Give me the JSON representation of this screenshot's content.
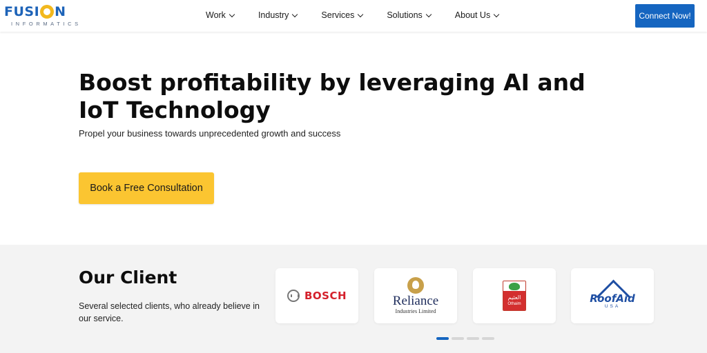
{
  "brand": {
    "name_part1": "FUSI",
    "name_part2": "N",
    "tagline": "INFORMATICS",
    "brand_blue": "#1d63b8",
    "brand_yellow": "#f2b81d"
  },
  "nav": {
    "items": [
      {
        "label": "Work",
        "icon": "chevron-down-icon"
      },
      {
        "label": "Industry",
        "icon": "chevron-down-icon"
      },
      {
        "label": "Services",
        "icon": "chevron-down-icon"
      },
      {
        "label": "Solutions",
        "icon": "chevron-down-icon"
      },
      {
        "label": "About Us",
        "icon": "chevron-down-icon"
      }
    ],
    "cta_label": "Connect Now!",
    "cta_color": "#1565c0"
  },
  "hero": {
    "title": "Boost profitability by leveraging AI and IoT Technology",
    "subtitle": "Propel your business towards unprecedented growth and success",
    "button_label": "Book a Free Consultation",
    "button_color": "#fbc531"
  },
  "clients": {
    "title": "Our Client",
    "description": "Several selected clients, who already believe in our service.",
    "logos": [
      {
        "name": "BOSCH",
        "icon": "bosch-logo"
      },
      {
        "name": "Reliance",
        "sub": "Industries Limited",
        "icon": "reliance-logo"
      },
      {
        "name": "العثيم",
        "sub": "Othaim",
        "icon": "othaim-logo"
      },
      {
        "name": "RoofAid",
        "sub": "USA",
        "icon": "roofaid-logo"
      }
    ],
    "carousel_active_index": 0,
    "carousel_count": 4
  }
}
